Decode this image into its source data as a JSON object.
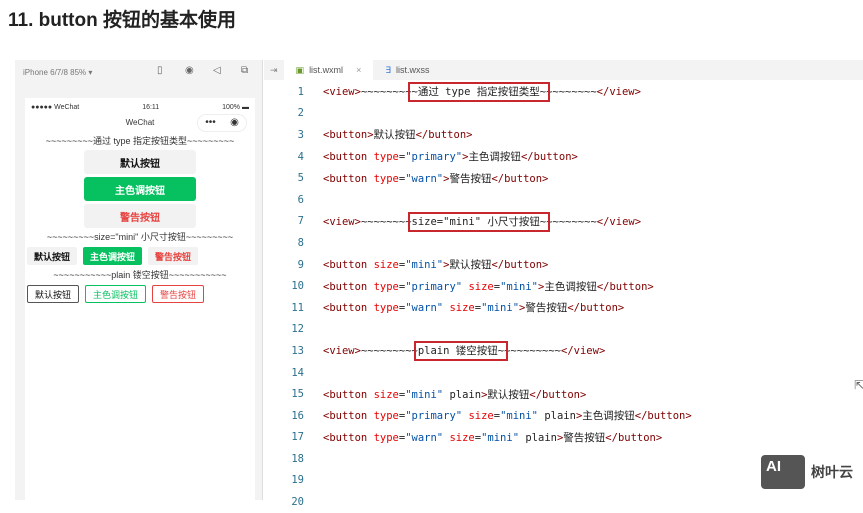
{
  "title": "11. button 按钮的基本使用",
  "simulator": {
    "device": "iPhone 6/7/8 85% ▾",
    "status": {
      "carrier": "●●●●● WeChat",
      "time": "16:11",
      "battery": "100% ▬"
    },
    "nav_title": "WeChat",
    "capsule_more": "•••",
    "capsule_close": "◉",
    "sep1": "~~~~~~~~~通过 type 指定按钮类型~~~~~~~~~",
    "buttons": [
      "默认按钮",
      "主色调按钮",
      "警告按钮"
    ],
    "sep2": "~~~~~~~~~size=\"mini\" 小尺寸按钮~~~~~~~~~",
    "sep3": "~~~~~~~~~~~plain 镂空按钮~~~~~~~~~~~"
  },
  "tabs": [
    {
      "label": "list.wxml",
      "close": "×"
    },
    {
      "label": "list.wxss"
    }
  ],
  "code": [
    [
      {
        "c": "tag",
        "s": "<view>"
      },
      {
        "c": "text",
        "s": "~~~~~~~~"
      },
      {
        "c": "text",
        "s": "~通过 type 指定按钮类型~",
        "box": true
      },
      {
        "c": "text",
        "s": "~~~~~~~~"
      },
      {
        "c": "tag",
        "s": "</view>"
      }
    ],
    [],
    [
      {
        "c": "tag",
        "s": "<button>"
      },
      {
        "c": "text",
        "s": "默认按钮"
      },
      {
        "c": "tag",
        "s": "</button>"
      }
    ],
    [
      {
        "c": "tag",
        "s": "<button "
      },
      {
        "c": "attr",
        "s": "type"
      },
      {
        "c": "text",
        "s": "="
      },
      {
        "c": "val",
        "s": "\"primary\""
      },
      {
        "c": "tag",
        "s": ">"
      },
      {
        "c": "text",
        "s": "主色调按钮"
      },
      {
        "c": "tag",
        "s": "</button>"
      }
    ],
    [
      {
        "c": "tag",
        "s": "<button "
      },
      {
        "c": "attr",
        "s": "type"
      },
      {
        "c": "text",
        "s": "="
      },
      {
        "c": "val",
        "s": "\"warn\""
      },
      {
        "c": "tag",
        "s": ">"
      },
      {
        "c": "text",
        "s": "警告按钮"
      },
      {
        "c": "tag",
        "s": "</button>"
      }
    ],
    [],
    [
      {
        "c": "tag",
        "s": "<view>"
      },
      {
        "c": "text",
        "s": "~~~~~~~~"
      },
      {
        "c": "text",
        "s": "size=\"mini\" 小尺寸按钮~",
        "box": true
      },
      {
        "c": "text",
        "s": "~~~~~~~~"
      },
      {
        "c": "tag",
        "s": "</view>"
      }
    ],
    [],
    [
      {
        "c": "tag",
        "s": "<button "
      },
      {
        "c": "attr",
        "s": "size"
      },
      {
        "c": "text",
        "s": "="
      },
      {
        "c": "val",
        "s": "\"mini\""
      },
      {
        "c": "tag",
        "s": ">"
      },
      {
        "c": "text",
        "s": "默认按钮"
      },
      {
        "c": "tag",
        "s": "</button>"
      }
    ],
    [
      {
        "c": "tag",
        "s": "<button "
      },
      {
        "c": "attr",
        "s": "type"
      },
      {
        "c": "text",
        "s": "="
      },
      {
        "c": "val",
        "s": "\"primary\""
      },
      {
        "c": "text",
        "s": " "
      },
      {
        "c": "attr",
        "s": "size"
      },
      {
        "c": "text",
        "s": "="
      },
      {
        "c": "val",
        "s": "\"mini\""
      },
      {
        "c": "tag",
        "s": ">"
      },
      {
        "c": "text",
        "s": "主色调按钮"
      },
      {
        "c": "tag",
        "s": "</button>"
      }
    ],
    [
      {
        "c": "tag",
        "s": "<button "
      },
      {
        "c": "attr",
        "s": "type"
      },
      {
        "c": "text",
        "s": "="
      },
      {
        "c": "val",
        "s": "\"warn\""
      },
      {
        "c": "text",
        "s": " "
      },
      {
        "c": "attr",
        "s": "size"
      },
      {
        "c": "text",
        "s": "="
      },
      {
        "c": "val",
        "s": "\"mini\""
      },
      {
        "c": "tag",
        "s": ">"
      },
      {
        "c": "text",
        "s": "警告按钮"
      },
      {
        "c": "tag",
        "s": "</button>"
      }
    ],
    [],
    [
      {
        "c": "tag",
        "s": "<view>"
      },
      {
        "c": "text",
        "s": "~~~~~~~~~"
      },
      {
        "c": "text",
        "s": "plain 镂空按钮~",
        "box": true
      },
      {
        "c": "text",
        "s": "~~~~~~~~~"
      },
      {
        "c": "tag",
        "s": "</view>"
      }
    ],
    [],
    [
      {
        "c": "tag",
        "s": "<button "
      },
      {
        "c": "attr",
        "s": "size"
      },
      {
        "c": "text",
        "s": "="
      },
      {
        "c": "val",
        "s": "\"mini\""
      },
      {
        "c": "text",
        "s": " plain"
      },
      {
        "c": "tag",
        "s": ">"
      },
      {
        "c": "text",
        "s": "默认按钮"
      },
      {
        "c": "tag",
        "s": "</button>"
      }
    ],
    [
      {
        "c": "tag",
        "s": "<button "
      },
      {
        "c": "attr",
        "s": "type"
      },
      {
        "c": "text",
        "s": "="
      },
      {
        "c": "val",
        "s": "\"primary\""
      },
      {
        "c": "text",
        "s": " "
      },
      {
        "c": "attr",
        "s": "size"
      },
      {
        "c": "text",
        "s": "="
      },
      {
        "c": "val",
        "s": "\"mini\""
      },
      {
        "c": "text",
        "s": " plain"
      },
      {
        "c": "tag",
        "s": ">"
      },
      {
        "c": "text",
        "s": "主色调按钮"
      },
      {
        "c": "tag",
        "s": "</button>"
      }
    ],
    [
      {
        "c": "tag",
        "s": "<button "
      },
      {
        "c": "attr",
        "s": "type"
      },
      {
        "c": "text",
        "s": "="
      },
      {
        "c": "val",
        "s": "\"warn\""
      },
      {
        "c": "text",
        "s": " "
      },
      {
        "c": "attr",
        "s": "size"
      },
      {
        "c": "text",
        "s": "="
      },
      {
        "c": "val",
        "s": "\"mini\""
      },
      {
        "c": "text",
        "s": " plain"
      },
      {
        "c": "tag",
        "s": ">"
      },
      {
        "c": "text",
        "s": "警告按钮"
      },
      {
        "c": "tag",
        "s": "</button>"
      }
    ],
    [],
    [],
    []
  ],
  "logo": {
    "mark": "AI",
    "name": "树叶云"
  },
  "colors": {
    "primary": "#07c160",
    "warn": "#e64340",
    "highlight": "#c8282d"
  }
}
